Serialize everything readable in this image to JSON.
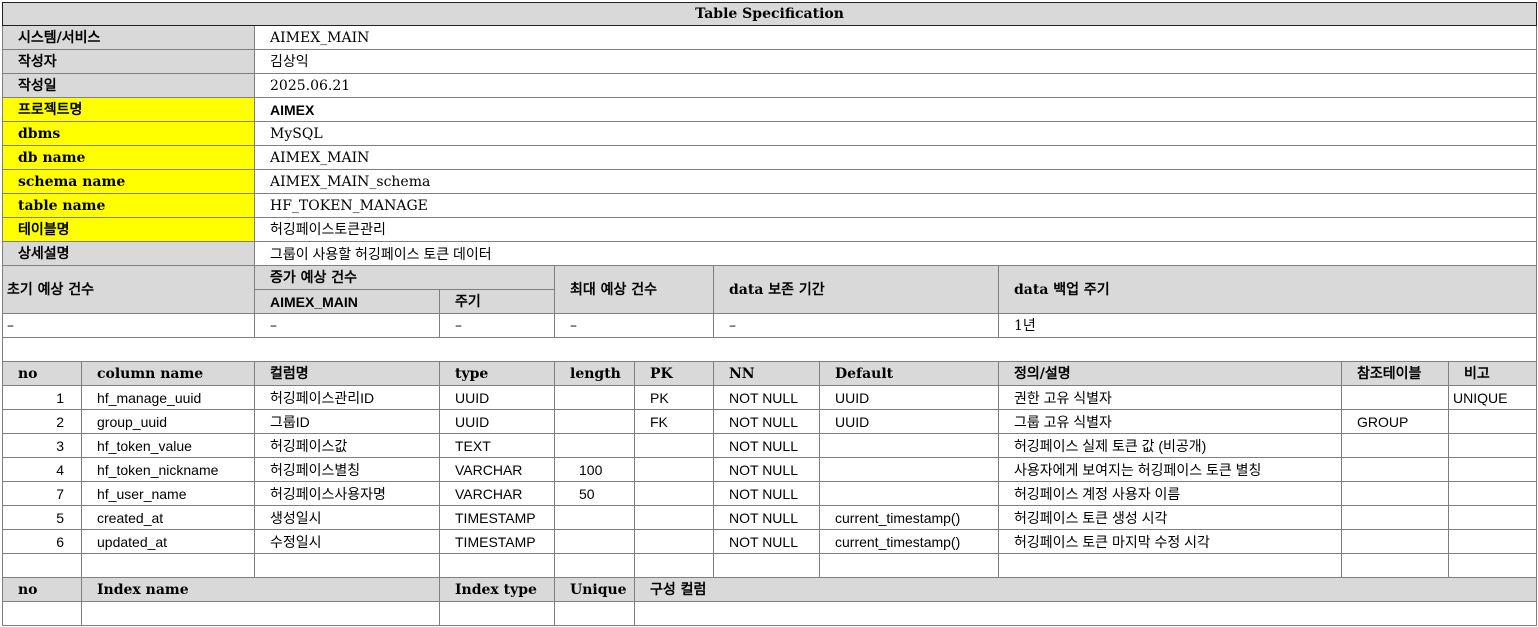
{
  "title": "Table Specification",
  "meta_rows": [
    {
      "label": "시스템/서비스",
      "value": "AIMEX_MAIN",
      "highlight": false
    },
    {
      "label": "작성자",
      "value": "김상익",
      "highlight": false
    },
    {
      "label": "작성일",
      "value": "2025.06.21",
      "highlight": false
    },
    {
      "label": "프로젝트명",
      "value": "AIMEX",
      "highlight": true
    },
    {
      "label": "dbms",
      "value": "MySQL",
      "highlight": true
    },
    {
      "label": "db name",
      "value": "AIMEX_MAIN",
      "highlight": true
    },
    {
      "label": "schema name",
      "value": "AIMEX_MAIN_schema",
      "highlight": true
    },
    {
      "label": "table name",
      "value": "HF_TOKEN_MANAGE",
      "highlight": true
    },
    {
      "label": "테이블명",
      "value": "허깅페이스토큰관리",
      "highlight": true
    },
    {
      "label": "상세설명",
      "value": "그룹이 사용할 허깅페이스 토큰 데이터",
      "highlight": false
    }
  ],
  "volume": {
    "initial_label": "초기 예상 건수",
    "increase_label": "증가 예상 건수",
    "increase_sub1": "AIMEX_MAIN",
    "increase_sub2": "주기",
    "max_label": "최대 예상 건수",
    "retention_label": "data 보존 기간",
    "backup_label": "data 백업 주기",
    "values": [
      "–",
      "–",
      "–",
      "–",
      "–",
      "1년"
    ]
  },
  "columns_header": [
    "no",
    "column name",
    "컬럼명",
    "type",
    "length",
    "PK",
    "NN",
    "Default",
    "정의/설명",
    "참조테이블",
    "비고"
  ],
  "columns": [
    {
      "no": "1",
      "name": "hf_manage_uuid",
      "kname": "허깅페이스관리ID",
      "type": "UUID",
      "length": "",
      "pk": "PK",
      "nn": "NOT NULL",
      "default": "UUID",
      "desc": "권한 고유 식별자",
      "ref": "",
      "note": "UNIQUE"
    },
    {
      "no": "2",
      "name": "group_uuid",
      "kname": "그룹ID",
      "type": "UUID",
      "length": "",
      "pk": "FK",
      "nn": "NOT NULL",
      "default": "UUID",
      "desc": "그룹 고유 식별자",
      "ref": "GROUP",
      "note": ""
    },
    {
      "no": "3",
      "name": "hf_token_value",
      "kname": "허깅페이스값",
      "type": "TEXT",
      "length": "",
      "pk": "",
      "nn": "NOT NULL",
      "default": "",
      "desc": "허깅페이스 실제 토큰 값 (비공개)",
      "ref": "",
      "note": ""
    },
    {
      "no": "4",
      "name": "hf_token_nickname",
      "kname": "허깅페이스별칭",
      "type": "VARCHAR",
      "length": "100",
      "pk": "",
      "nn": "NOT NULL",
      "default": "",
      "desc": "사용자에게 보여지는 허깅페이스 토큰 별칭",
      "ref": "",
      "note": ""
    },
    {
      "no": "7",
      "name": "hf_user_name",
      "kname": "허깅페이스사용자명",
      "type": "VARCHAR",
      "length": "50",
      "pk": "",
      "nn": "NOT NULL",
      "default": "",
      "desc": "허깅페이스 계정 사용자 이름",
      "ref": "",
      "note": ""
    },
    {
      "no": "5",
      "name": "created_at",
      "kname": "생성일시",
      "type": "TIMESTAMP",
      "length": "",
      "pk": "",
      "nn": "NOT NULL",
      "default": "current_timestamp()",
      "desc": "허깅페이스 토큰 생성 시각",
      "ref": "",
      "note": ""
    },
    {
      "no": "6",
      "name": "updated_at",
      "kname": "수정일시",
      "type": "TIMESTAMP",
      "length": "",
      "pk": "",
      "nn": "NOT NULL",
      "default": "current_timestamp()",
      "desc": "허깅페이스 토큰 마지막 수정 시각",
      "ref": "",
      "note": ""
    }
  ],
  "index_header": [
    "no",
    "Index name",
    "Index type",
    "Unique",
    "구성 컬럼"
  ]
}
